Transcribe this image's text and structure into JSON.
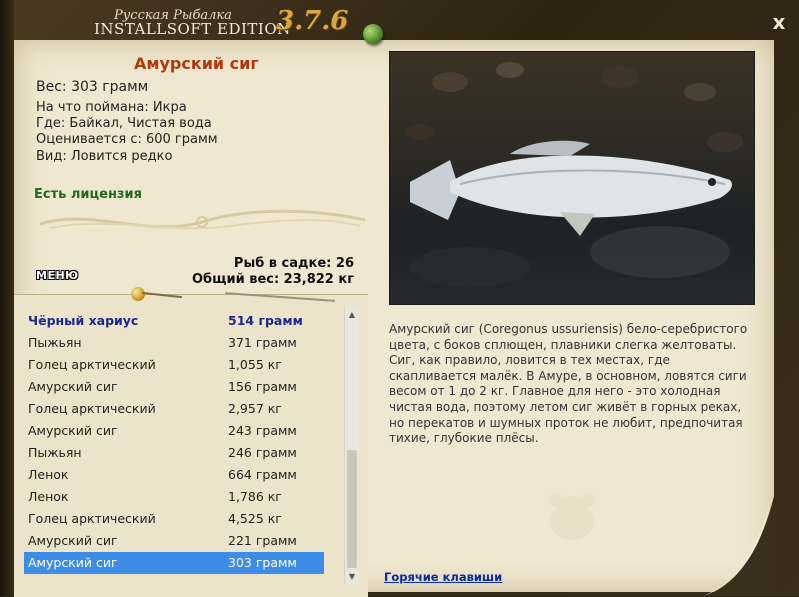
{
  "app": {
    "title_line": "Русская Рыбалка",
    "edition": "INSTALLSOFT EDITION",
    "version": "3.7.6",
    "close_label": "x"
  },
  "fish": {
    "name": "Амурский сиг",
    "weight": "Вес: 303 грамм",
    "caught_on": "На что поймана: Икра",
    "location": "Где: Байкал, Чистая вода",
    "rated_from": "Оценивается с: 600 грамм",
    "type": "Вид: Ловится редко",
    "license": "Есть лицензия"
  },
  "stats": {
    "in_keepnet": "Рыб в садке: 26",
    "total_weight": "Общий вес: 23,822 кг"
  },
  "menu_label": "МЕНЮ",
  "catch_list": [
    {
      "name": "Чёрный хариус",
      "weight": "514 грамм",
      "state": "header"
    },
    {
      "name": "Пыжьян",
      "weight": "371 грамм"
    },
    {
      "name": "Голец арктический",
      "weight": "1,055 кг"
    },
    {
      "name": "Амурский сиг",
      "weight": "156 грамм"
    },
    {
      "name": "Голец арктический",
      "weight": "2,957 кг"
    },
    {
      "name": "Амурский сиг",
      "weight": "243 грамм"
    },
    {
      "name": "Пыжьян",
      "weight": "246 грамм"
    },
    {
      "name": "Ленок",
      "weight": "664 грамм"
    },
    {
      "name": "Ленок",
      "weight": "1,786 кг"
    },
    {
      "name": "Голец арктический",
      "weight": "4,525 кг"
    },
    {
      "name": "Амурский сиг",
      "weight": "221 грамм"
    },
    {
      "name": "Амурский сиг",
      "weight": "303 грамм",
      "state": "selected"
    }
  ],
  "description": "Амурский сиг (Coregonus ussuriensis) бело-серебристого цвета, с боков сплющен, плавники слегка желтоваты. Сиг, как правило, ловится в тех местах, где скапливается малёк. В Амуре, в основном, ловятся сиги весом от 1 до 2 кг. Главное для него - это холодная чистая вода, поэтому летом сиг живёт в горных реках, но перекатов и шумных проток не любит, предпочитая тихие, глубокие плёсы.",
  "hotkeys_label": "Горячие клавиши",
  "colors": {
    "fish_name": "#b03a10",
    "license": "#1e6a1e",
    "list_header": "#1a2a8a",
    "selection": "#3d8de6",
    "link": "#0a2a9a"
  }
}
